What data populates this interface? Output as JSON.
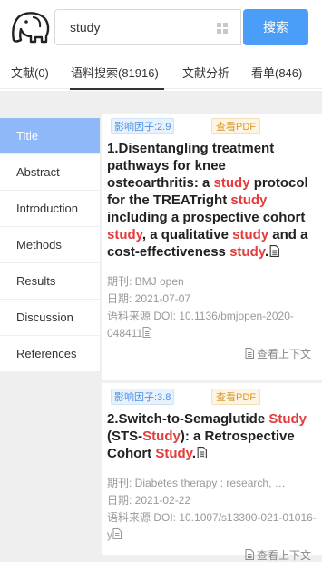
{
  "search": {
    "value": "study",
    "button_label": "搜索"
  },
  "tabs": [
    {
      "label": "文献(0)"
    },
    {
      "label": "语料搜索(81916)"
    },
    {
      "label": "文献分析"
    },
    {
      "label": "看单(846)"
    }
  ],
  "side_nav": [
    {
      "label": "Title"
    },
    {
      "label": "Abstract"
    },
    {
      "label": "Introduction"
    },
    {
      "label": "Methods"
    },
    {
      "label": "Results"
    },
    {
      "label": "Discussion"
    },
    {
      "label": "References"
    }
  ],
  "results": [
    {
      "impact_factor": "影响因子:2.9",
      "pdf_label": "查看PDF",
      "title_segments": [
        {
          "text": "1.Disentangling treatment pathways for knee osteoarthritis: a ",
          "hl": false
        },
        {
          "text": "study",
          "hl": true
        },
        {
          "text": " protocol for the TREATright ",
          "hl": false
        },
        {
          "text": "study",
          "hl": true
        },
        {
          "text": " including a prospective cohort ",
          "hl": false
        },
        {
          "text": "study",
          "hl": true
        },
        {
          "text": ", a qualitative ",
          "hl": false
        },
        {
          "text": "study",
          "hl": true
        },
        {
          "text": " and a cost-effectiveness ",
          "hl": false
        },
        {
          "text": "study",
          "hl": true
        },
        {
          "text": ".",
          "hl": false
        }
      ],
      "journal": "期刊: BMJ open",
      "date": "日期: 2021-07-07",
      "doi": "语料来源 DOI: 10.1136/bmjopen-2020-048411",
      "context_label": "查看上下文"
    },
    {
      "impact_factor": "影响因子:3.8",
      "pdf_label": "查看PDF",
      "title_segments": [
        {
          "text": "2.Switch-to-Semaglutide ",
          "hl": false
        },
        {
          "text": "Study",
          "hl": true
        },
        {
          "text": " (STS-",
          "hl": false
        },
        {
          "text": "Study",
          "hl": true
        },
        {
          "text": "): a Retrospective Cohort ",
          "hl": false
        },
        {
          "text": "Study",
          "hl": true
        },
        {
          "text": ".",
          "hl": false
        }
      ],
      "journal": "期刊: Diabetes therapy : research, …",
      "date": "日期: 2021-02-22",
      "doi": "语料来源 DOI: 10.1007/s13300-021-01016-y",
      "context_label": "查看上下文"
    }
  ],
  "colors": {
    "accent": "#4a9ef8",
    "highlight": "#e23c3c",
    "active_nav": "#8eb8f7"
  }
}
